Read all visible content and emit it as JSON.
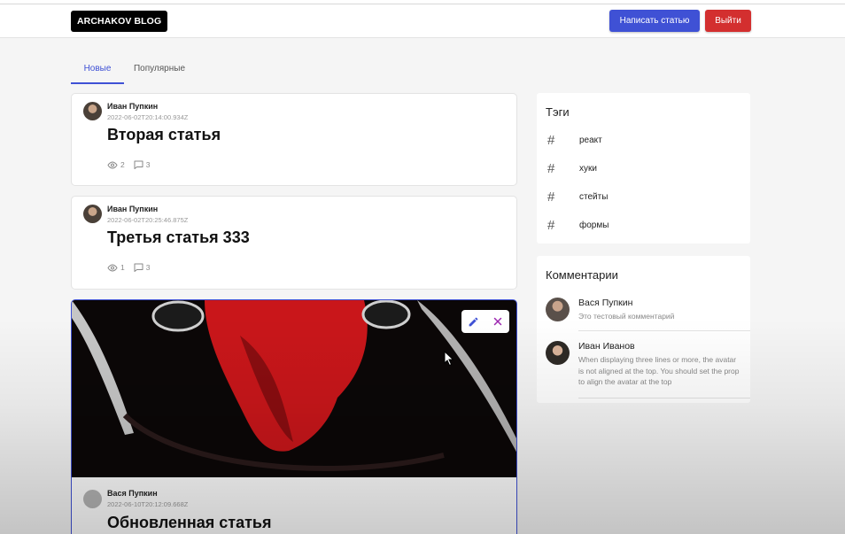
{
  "header": {
    "logo": "ARCHAKOV BLOG",
    "write_button": "Написать статью",
    "logout_button": "Выйти"
  },
  "tabs": {
    "new": "Новые",
    "popular": "Популярные"
  },
  "posts": [
    {
      "author": "Иван Пупкин",
      "date": "2022-06-02T20:14:00.934Z",
      "title": "Вторая статья",
      "views": "2",
      "comments": "3"
    },
    {
      "author": "Иван Пупкин",
      "date": "2022-06-02T20:25:46.875Z",
      "title": "Третья статья 333",
      "views": "1",
      "comments": "3"
    },
    {
      "author": "Вася Пупкин",
      "date": "2022-06-10T20:12:09.668Z",
      "title": "Обновленная статья"
    }
  ],
  "tags": {
    "title": "Тэги",
    "items": [
      "реакт",
      "хуки",
      "стейты",
      "формы"
    ]
  },
  "comments": {
    "title": "Комментарии",
    "items": [
      {
        "name": "Вася Пупкин",
        "text": "Это тестовый комментарий"
      },
      {
        "name": "Иван Иванов",
        "text": "When displaying three lines or more, the avatar is not aligned at the top. You should set the prop to align the avatar at the top"
      }
    ]
  },
  "colors": {
    "primary": "#3f51d5",
    "danger": "#d32f2f",
    "logo_bg": "#000000"
  }
}
